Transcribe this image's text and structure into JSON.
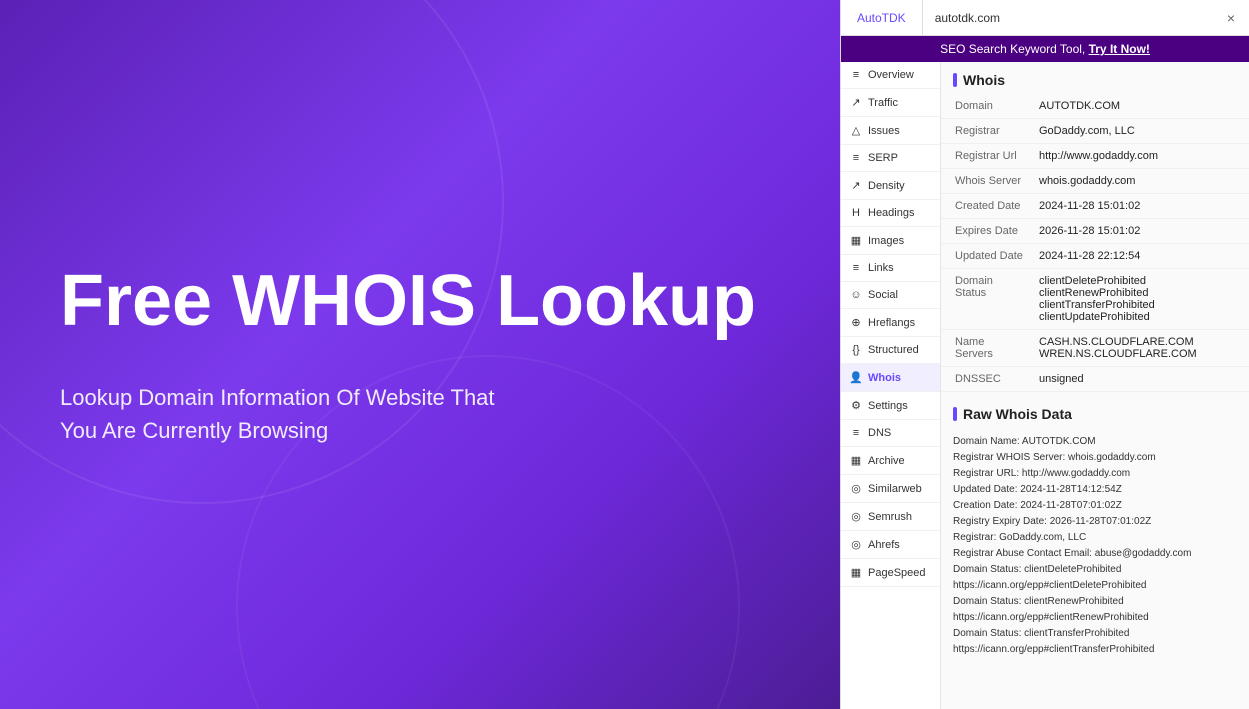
{
  "hero": {
    "title": "Free WHOIS  Lookup",
    "subtitle_line1": "Lookup Domain Information Of Website That",
    "subtitle_line2": "You Are Currently Browsing"
  },
  "panel": {
    "tab_autotdk": "AutoTDK",
    "tab_domain": "autotdk.com",
    "close_label": "×",
    "seo_bar_text": "SEO Search Keyword Tool, ",
    "seo_bar_link": "Try It Now!"
  },
  "sidebar": {
    "items": [
      {
        "id": "overview",
        "icon": "≡",
        "label": "Overview"
      },
      {
        "id": "traffic",
        "icon": "↗",
        "label": "Traffic"
      },
      {
        "id": "issues",
        "icon": "△",
        "label": "Issues"
      },
      {
        "id": "serp",
        "icon": "≡",
        "label": "SERP"
      },
      {
        "id": "density",
        "icon": "↗",
        "label": "Density"
      },
      {
        "id": "headings",
        "icon": "H",
        "label": "Headings"
      },
      {
        "id": "images",
        "icon": "▦",
        "label": "Images"
      },
      {
        "id": "links",
        "icon": "≡",
        "label": "Links"
      },
      {
        "id": "social",
        "icon": "☺",
        "label": "Social"
      },
      {
        "id": "hreflangs",
        "icon": "⊕",
        "label": "Hreflangs"
      },
      {
        "id": "structured",
        "icon": "{}",
        "label": "Structured"
      },
      {
        "id": "whois",
        "icon": "👤",
        "label": "Whois"
      },
      {
        "id": "settings",
        "icon": "⚙",
        "label": "Settings"
      },
      {
        "id": "dns",
        "icon": "≡",
        "label": "DNS"
      },
      {
        "id": "archive",
        "icon": "▦",
        "label": "Archive"
      },
      {
        "id": "similarweb",
        "icon": "◎",
        "label": "Similarweb"
      },
      {
        "id": "semrush",
        "icon": "◎",
        "label": "Semrush"
      },
      {
        "id": "ahrefs",
        "icon": "◎",
        "label": "Ahrefs"
      },
      {
        "id": "pagespeed",
        "icon": "▦",
        "label": "PageSpeed"
      }
    ]
  },
  "whois": {
    "section_title": "Whois",
    "rows": [
      {
        "label": "Domain",
        "value": "AUTOTDK.COM"
      },
      {
        "label": "Registrar",
        "value": "GoDaddy.com, LLC"
      },
      {
        "label": "Registrar Url",
        "value": "http://www.godaddy.com"
      },
      {
        "label": "Whois Server",
        "value": "whois.godaddy.com"
      },
      {
        "label": "Created Date",
        "value": "2024-11-28 15:01:02"
      },
      {
        "label": "Expires Date",
        "value": "2026-11-28 15:01:02"
      },
      {
        "label": "Updated Date",
        "value": "2024-11-28 22:12:54"
      },
      {
        "label": "Domain Status",
        "value": "clientDeleteProhibited\nclientRenewProhibited\nclientTransferProhibited\nclientUpdateProhibited"
      },
      {
        "label": "Name Servers",
        "value": "CASH.NS.CLOUDFLARE.COM\nWREN.NS.CLOUDFLARE.COM"
      },
      {
        "label": "DNSSEC",
        "value": "unsigned"
      }
    ]
  },
  "raw_whois": {
    "section_title": "Raw Whois Data",
    "content": "Domain Name: AUTOTDK.COM\nRegistrar WHOIS Server: whois.godaddy.com\nRegistrar URL: http://www.godaddy.com\nUpdated Date: 2024-11-28T14:12:54Z\nCreation Date: 2024-11-28T07:01:02Z\nRegistry Expiry Date: 2026-11-28T07:01:02Z\nRegistrar: GoDaddy.com, LLC\nRegistrar Abuse Contact Email: abuse@godaddy.com\nDomain Status: clientDeleteProhibited\nhttps://icann.org/epp#clientDeleteProhibited\nDomain Status: clientRenewProhibited\nhttps://icann.org/epp#clientRenewProhibited\nDomain Status: clientTransferProhibited\nhttps://icann.org/epp#clientTransferProhibited"
  },
  "colors": {
    "accent": "#6b48ff",
    "hero_bg": "#6d28d9"
  }
}
